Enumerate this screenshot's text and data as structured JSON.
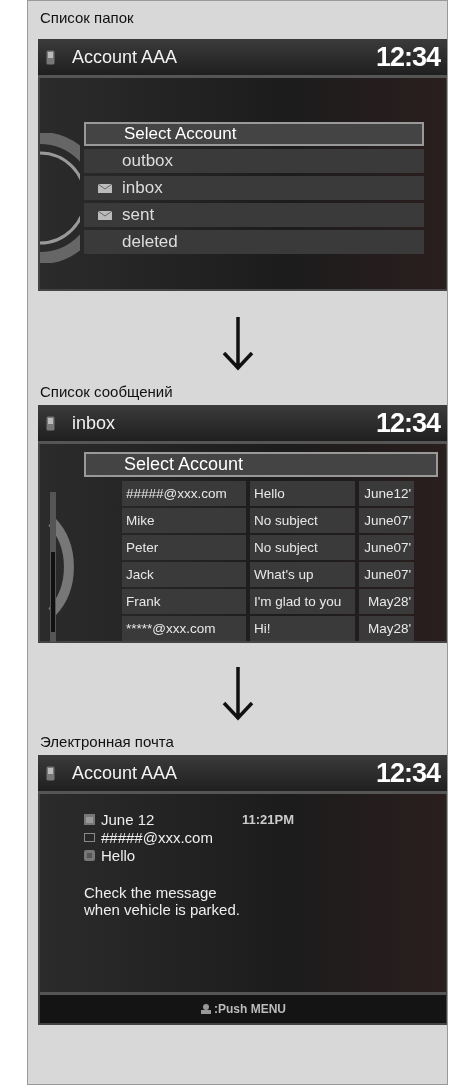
{
  "panels": [
    {
      "kind": "folder_list",
      "caption": "Список папок",
      "screen": {
        "title": "Account AAA",
        "clock": "12:34"
      },
      "items": [
        {
          "label": "Select Account",
          "selected": true,
          "has_icon": false
        },
        {
          "label": "outbox",
          "selected": false,
          "has_icon": false
        },
        {
          "label": "inbox",
          "selected": false,
          "has_icon": true
        },
        {
          "label": "sent",
          "selected": false,
          "has_icon": true
        },
        {
          "label": "deleted",
          "selected": false,
          "has_icon": false
        }
      ]
    },
    {
      "kind": "message_list",
      "caption": "Список сообщений",
      "screen": {
        "title": "inbox",
        "clock": "12:34"
      },
      "header": {
        "label": "Select Account",
        "selected": true
      },
      "rows": [
        {
          "sender": "#####@xxx.com",
          "subject": "Hello",
          "date": "June12'"
        },
        {
          "sender": "Mike",
          "subject": "No subject",
          "date": "June07'"
        },
        {
          "sender": "Peter",
          "subject": "No subject",
          "date": "June07'"
        },
        {
          "sender": "Jack",
          "subject": "What's up",
          "date": "June07'"
        },
        {
          "sender": "Frank",
          "subject": "I'm glad to you",
          "date": "May28'"
        },
        {
          "sender": "*****@xxx.com",
          "subject": "Hi!",
          "date": "May28'"
        }
      ]
    },
    {
      "kind": "message",
      "caption": "Электронная почта",
      "screen": {
        "title": "Account AAA",
        "clock": "12:34"
      },
      "date": "June 12",
      "time": "11:21PM",
      "sender": "#####@xxx.com",
      "subject": "Hello",
      "note": "Check the message\nwhen vehicle is parked.",
      "footer": ":Push MENU"
    }
  ]
}
